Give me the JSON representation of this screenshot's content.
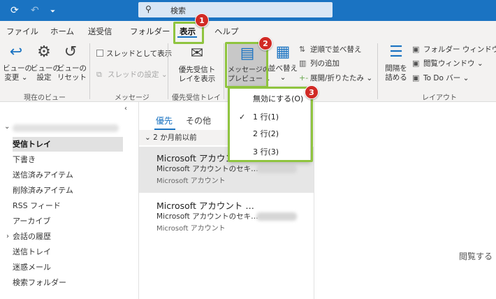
{
  "titlebar": {
    "search_placeholder": "検索",
    "icons": [
      "sync-icon",
      "undo-icon",
      "customize-toolbar-icon",
      "search-icon"
    ]
  },
  "menu": {
    "tabs": [
      "ファイル",
      "ホーム",
      "送受信",
      "フォルダー",
      "表示",
      "ヘルプ"
    ],
    "active_tab": "表示"
  },
  "ribbon": {
    "current_view": {
      "change_view": "ビューの\n変更 ⌄",
      "view_settings": "ビューの\n設定",
      "reset_view": "ビューの\nリセット",
      "group_label": "現在のビュー"
    },
    "messages": {
      "show_as_conversations": "スレッドとして表示",
      "conversation_settings": "スレッドの設定 ⌄",
      "group_label": "メッセージ"
    },
    "focused_inbox": {
      "show_focused_inbox": "優先受信ト\nレイを表示",
      "group_label": "優先受信トレイ"
    },
    "arrangement": {
      "message_preview": "メッセージの\nプレビュー ⌄",
      "arrange_by": "並べ替え\n⌄",
      "reverse_sort": "逆順で並べ替え",
      "add_columns": "列の追加",
      "expand_collapse": "展開/折りたたみ ⌄"
    },
    "layout": {
      "spacing": "間隔を\n詰める",
      "folder_pane": "フォルダー ウィンドウ ⌄",
      "reading_pane": "閲覧ウィンドウ ⌄",
      "todo_bar": "To Do バー ⌄",
      "group_label": "レイアウト"
    }
  },
  "folders": {
    "items": [
      "受信トレイ",
      "下書き",
      "送信済みアイテム",
      "削除済みアイテム",
      "RSS フィード",
      "アーカイブ",
      "会話の履歴",
      "送信トレイ",
      "迷惑メール",
      "検索フォルダー"
    ],
    "selected": "受信トレイ"
  },
  "message_list": {
    "tabs": [
      "優先",
      "その他"
    ],
    "group_header": "⌄  2 か月前以前",
    "messages": [
      {
        "sender": "Microsoft アカウン",
        "subject": "Microsoft アカウントのセキ…",
        "preview": "Microsoft アカウント"
      },
      {
        "sender": "Microsoft アカウント …",
        "subject": "Microsoft アカウントのセキ…",
        "preview": "Microsoft アカウント"
      }
    ]
  },
  "reading_pane": {
    "text": "閲覧する"
  },
  "preview_dropdown": {
    "items": [
      "無効にする(O)",
      "1 行(1)",
      "2 行(2)",
      "3 行(3)"
    ],
    "checked_index": 1
  },
  "annotations": {
    "badges": [
      "1",
      "2",
      "3"
    ],
    "highlight_color": "#8fc43f",
    "badge_color": "#d12a25"
  },
  "colors": {
    "titlebar": "#1a73c2",
    "ribbon": "#f3f2f1",
    "accent": "#1a73c2"
  }
}
